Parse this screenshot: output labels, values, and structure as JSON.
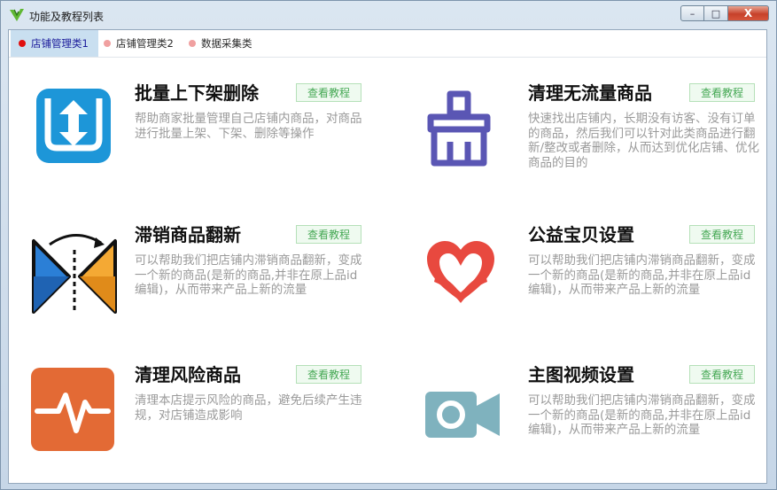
{
  "window": {
    "title": "功能及教程列表",
    "buttons": {
      "minimize": "–",
      "maximize": "□",
      "close": "X"
    }
  },
  "tabs": [
    {
      "label": "店铺管理类1",
      "active": true,
      "dot_color": "#e01010"
    },
    {
      "label": "店铺管理类2",
      "active": false,
      "dot_color": "#f0a0a0"
    },
    {
      "label": "数据采集类",
      "active": false,
      "dot_color": "#f0a0a0"
    }
  ],
  "cards": [
    {
      "title": "批量上下架删除",
      "button": "查看教程",
      "icon": "upload-download-icon",
      "description": "帮助商家批量管理自己店铺内商品，对商品进行批量上架、下架、删除等操作"
    },
    {
      "title": "清理无流量商品",
      "button": "查看教程",
      "icon": "broom-icon",
      "description": "快速找出店铺内，长期没有访客、没有订单的商品，然后我们可以针对此类商品进行翻新/整改或者删除，从而达到优化店铺、优化商品的目的"
    },
    {
      "title": "滞销商品翻新",
      "button": "查看教程",
      "icon": "flip-refresh-icon",
      "description": "可以帮助我们把店铺内滞销商品翻新，变成一个新的商品(是新的商品,并非在原上品id编辑)，从而带来产品上新的流量"
    },
    {
      "title": "公益宝贝设置",
      "button": "查看教程",
      "icon": "charity-heart-icon",
      "description": "可以帮助我们把店铺内滞销商品翻新，变成一个新的商品(是新的商品,并非在原上品id编辑)，从而带来产品上新的流量"
    },
    {
      "title": "清理风险商品",
      "button": "查看教程",
      "icon": "risk-pulse-icon",
      "description": "清理本店提示风险的商品，避免后续产生违规，对店铺造成影响"
    },
    {
      "title": "主图视频设置",
      "button": "查看教程",
      "icon": "video-camera-icon",
      "description": "可以帮助我们把店铺内滞销商品翻新，变成一个新的商品(是新的商品,并非在原上品id编辑)，从而带来产品上新的流量"
    }
  ],
  "colors": {
    "accent_green": "#45a854",
    "tab_active_bg": "#c9dff0",
    "description_gray": "#9a9a9a"
  }
}
